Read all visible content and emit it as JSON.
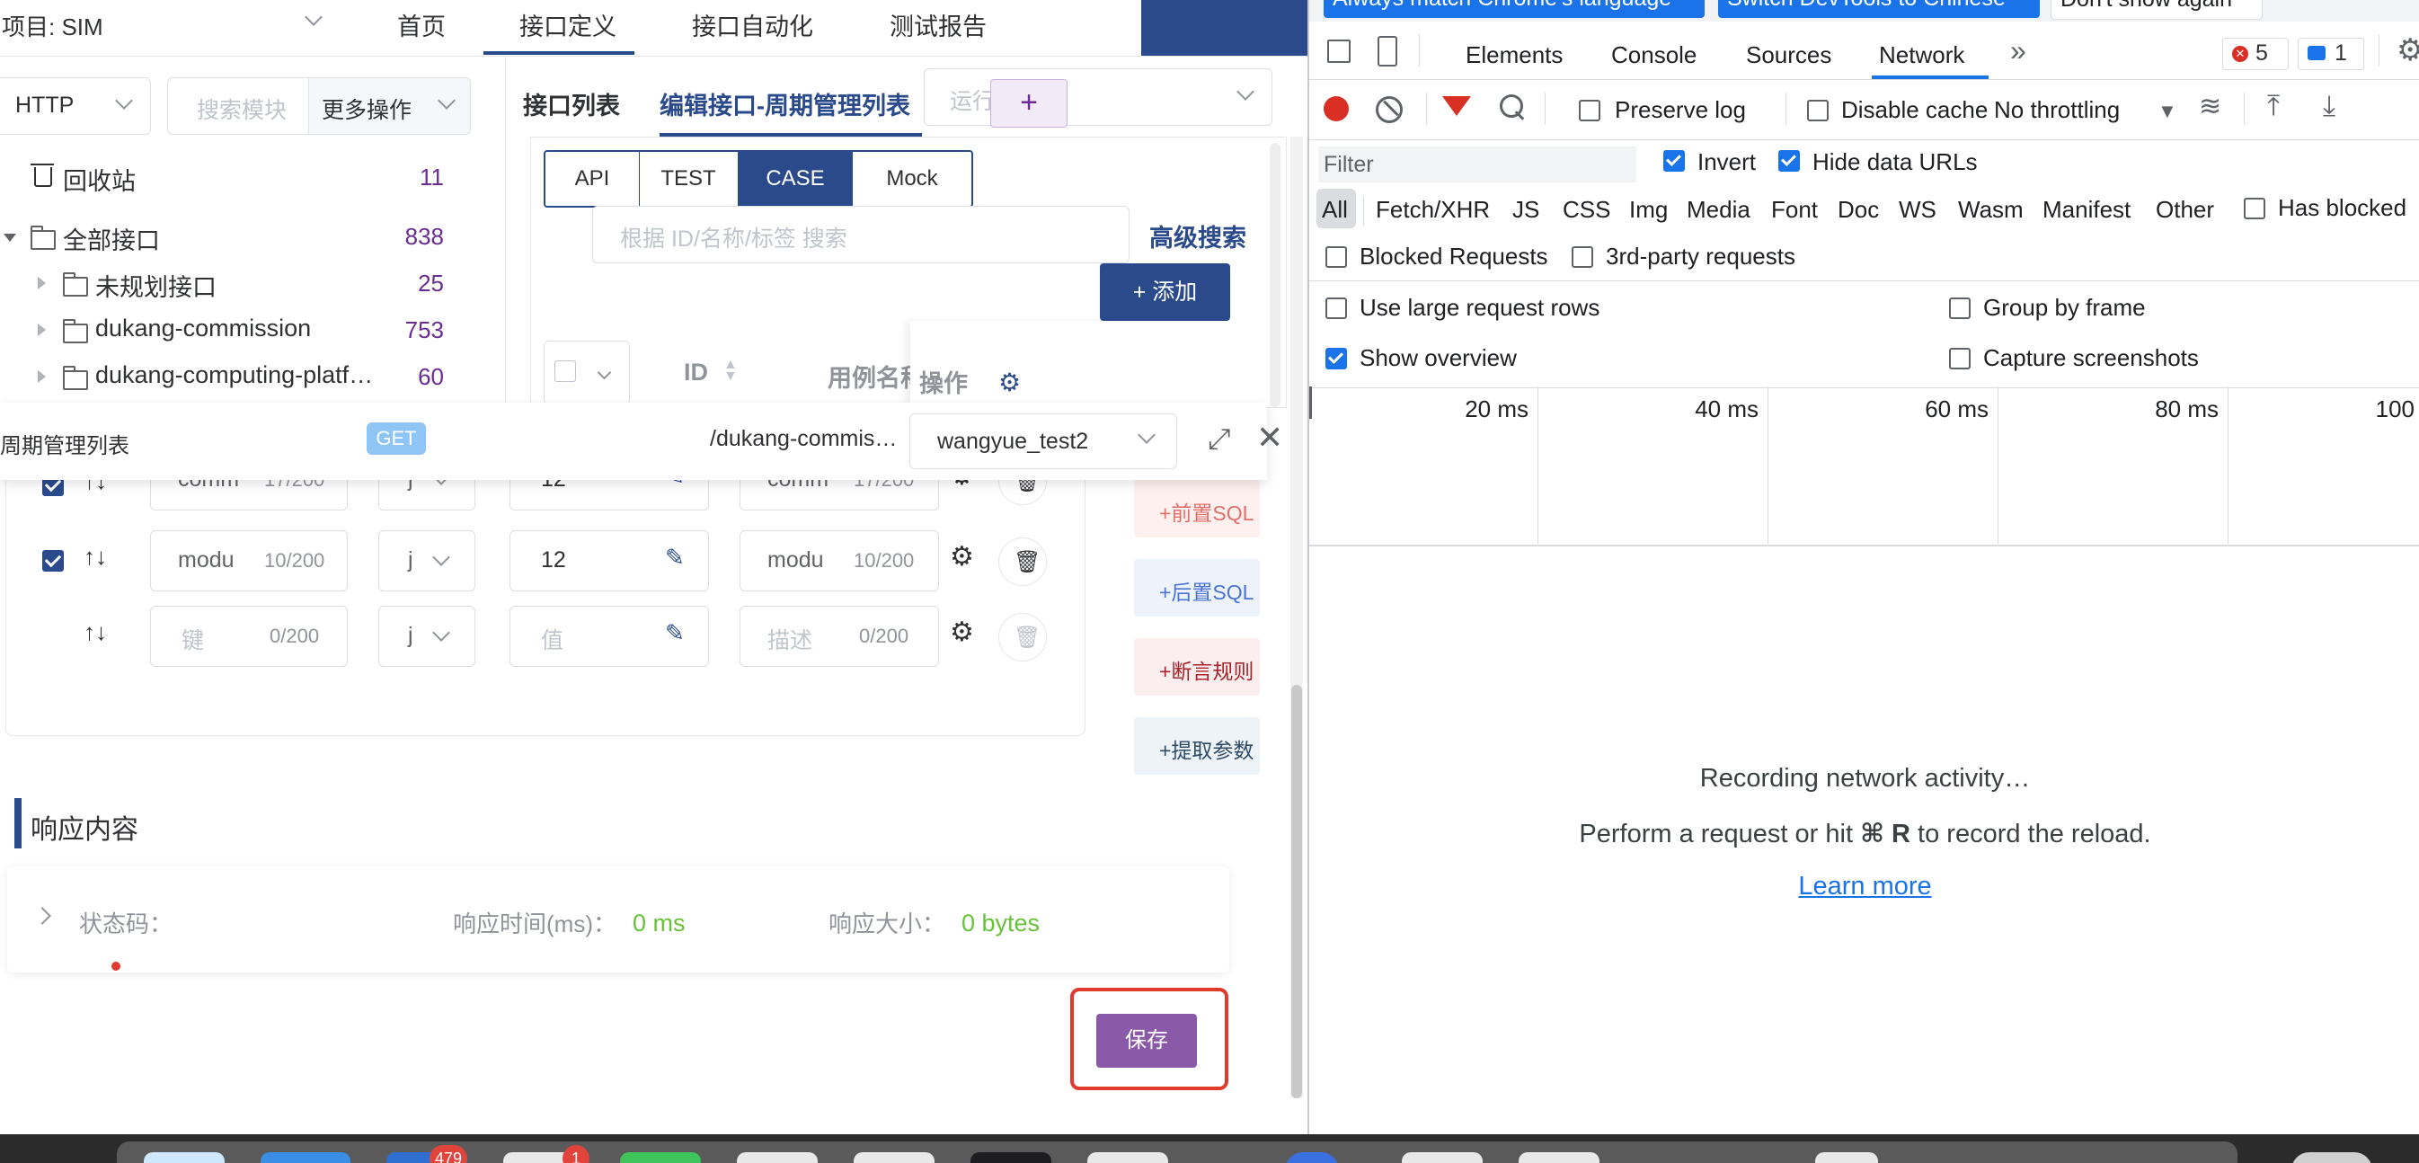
{
  "topnav": {
    "project_label": "项目: SIM",
    "items": [
      "首页",
      "接口定义",
      "接口自动化",
      "测试报告"
    ],
    "active_index": 1
  },
  "left_panel": {
    "protocol_select": "HTTP",
    "search_placeholder": "搜索模块",
    "more_actions": "更多操作",
    "recycle_label": "回收站",
    "recycle_count": "11",
    "tree": [
      {
        "label": "全部接口",
        "count": "838"
      },
      {
        "label": "未规划接口",
        "count": "25"
      },
      {
        "label": "dukang-commission",
        "count": "753"
      },
      {
        "label": "dukang-computing-platf…",
        "count": "60"
      }
    ]
  },
  "tabs": {
    "list_tab": "接口列表",
    "edit_tab": "编辑接口-周期管理列表",
    "close_symbol": "×",
    "run_env_placeholder": "运行",
    "add_symbol": "+"
  },
  "mode_tabs": {
    "items": [
      "API",
      "TEST",
      "CASE",
      "Mock"
    ],
    "active_index": 2
  },
  "case_search": {
    "placeholder": "根据 ID/名称/标签 搜索",
    "advanced": "高级搜索",
    "add_button": "+ 添加"
  },
  "table_header": {
    "id": "ID",
    "case_name": "用例名称",
    "actions": "操作"
  },
  "floating_bar": {
    "name": "周期管理列表",
    "method": "GET",
    "path": "/dukang-commiss…",
    "env": "wangyue_test2"
  },
  "params": [
    {
      "checked": true,
      "key": "comm",
      "key_count": "17/200",
      "type": "j",
      "value": "12",
      "desc": "comm",
      "desc_count": "17/200"
    },
    {
      "checked": true,
      "key": "modu",
      "key_count": "10/200",
      "type": "j",
      "value": "12",
      "desc": "modu",
      "desc_count": "10/200"
    },
    {
      "checked": false,
      "key_placeholder": "键",
      "key_count": "0/200",
      "type": "j",
      "value_placeholder": "值",
      "desc_placeholder": "描述",
      "desc_count": "0/200"
    }
  ],
  "side_buttons": {
    "pre_sql": "+前置SQL",
    "post_sql": "+后置SQL",
    "assert": "+断言规则",
    "extract": "+提取参数"
  },
  "response": {
    "title": "响应内容",
    "status_label": "状态码：",
    "time_label": "响应时间(ms)：",
    "time_value": "0 ms",
    "size_label": "响应大小：",
    "size_value": "0 bytes"
  },
  "save_button": "保存",
  "devtools": {
    "banner": {
      "match_lang": "Always match Chrome's language",
      "switch_cn": "Switch DevTools to Chinese",
      "dont_show": "Don't show again"
    },
    "tabs": [
      "Elements",
      "Console",
      "Sources",
      "Network"
    ],
    "active_tab": "Network",
    "more_tabs": "»",
    "error_count": "5",
    "msg_count": "1",
    "toolbar": {
      "preserve_log": "Preserve log",
      "disable_cache": "Disable cache",
      "throttling": "No throttling"
    },
    "filter": {
      "placeholder": "Filter",
      "invert": "Invert",
      "hide_data_urls": "Hide data URLs"
    },
    "types": [
      "All",
      "Fetch/XHR",
      "JS",
      "CSS",
      "Img",
      "Media",
      "Font",
      "Doc",
      "WS",
      "Wasm",
      "Manifest",
      "Other"
    ],
    "has_blocked": "Has blocked",
    "blocked_requests": "Blocked Requests",
    "third_party": "3rd-party requests",
    "options": {
      "large_rows": "Use large request rows",
      "group_by_frame": "Group by frame",
      "show_overview": "Show overview",
      "capture_screenshots": "Capture screenshots"
    },
    "ticks": [
      "20 ms",
      "40 ms",
      "60 ms",
      "80 ms",
      "100"
    ],
    "empty": {
      "recording": "Recording network activity…",
      "perform_prefix": "Perform a request or hit ",
      "shortcut": "⌘ R",
      "perform_suffix": " to record the reload.",
      "learn_more": "Learn more"
    }
  },
  "dock": {
    "badge_1": "479",
    "badge_2": "1"
  },
  "colors": {
    "brand": "#2a4a8c",
    "purple": "#6b2c91",
    "save_button": "#8a5aa8",
    "highlight_border": "#e03a2f",
    "green_value": "#67c23a",
    "link_blue": "#1a73e8"
  }
}
